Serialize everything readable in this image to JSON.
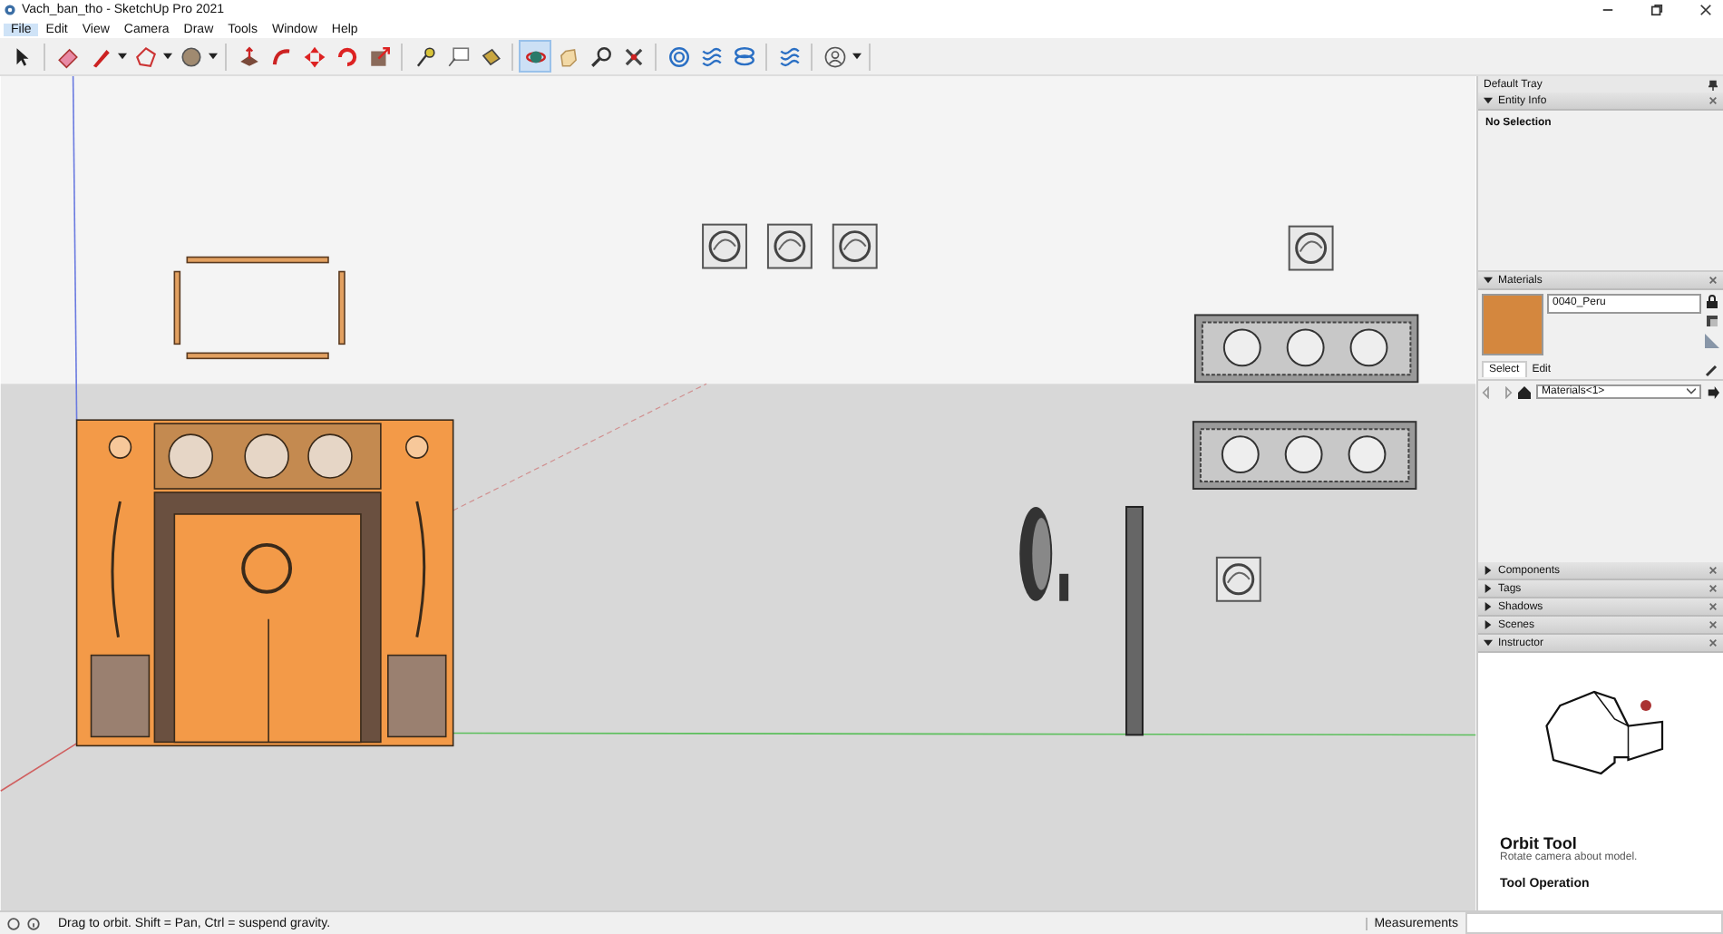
{
  "window": {
    "title": "Vach_ban_tho - SketchUp Pro 2021"
  },
  "menu": [
    {
      "label": "File",
      "selected": true
    },
    {
      "label": "Edit",
      "selected": false
    },
    {
      "label": "View",
      "selected": false
    },
    {
      "label": "Camera",
      "selected": false
    },
    {
      "label": "Draw",
      "selected": false
    },
    {
      "label": "Tools",
      "selected": false
    },
    {
      "label": "Window",
      "selected": false
    },
    {
      "label": "Help",
      "selected": false
    }
  ],
  "toolbar": [
    [
      {
        "kind": "arrow",
        "selected": false
      }
    ],
    [
      {
        "kind": "eraser",
        "selected": false
      },
      {
        "kind": "pencil",
        "selected": false
      },
      {
        "kind": "caret",
        "selected": false
      },
      {
        "kind": "polygon",
        "selected": false
      },
      {
        "kind": "caret",
        "selected": false
      },
      {
        "kind": "ball",
        "selected": false
      },
      {
        "kind": "caret",
        "selected": false
      }
    ],
    [
      {
        "kind": "push",
        "selected": false
      },
      {
        "kind": "curve",
        "selected": false
      },
      {
        "kind": "move",
        "selected": false
      },
      {
        "kind": "rotate",
        "selected": false
      },
      {
        "kind": "scale",
        "selected": false
      }
    ],
    [
      {
        "kind": "tape",
        "selected": false
      },
      {
        "kind": "label",
        "selected": false
      },
      {
        "kind": "bucket",
        "selected": false
      }
    ],
    [
      {
        "kind": "orbit",
        "selected": true
      },
      {
        "kind": "hand",
        "selected": false
      },
      {
        "kind": "zoom",
        "selected": false
      },
      {
        "kind": "cross",
        "selected": false
      }
    ],
    [
      {
        "kind": "target",
        "selected": false
      },
      {
        "kind": "waves",
        "selected": false
      },
      {
        "kind": "layers",
        "selected": false
      }
    ],
    [
      {
        "kind": "waves",
        "selected": false
      }
    ],
    [
      {
        "kind": "user",
        "selected": false
      },
      {
        "kind": "caret",
        "selected": false
      }
    ]
  ],
  "tray": {
    "title": "Default Tray",
    "entity_info": {
      "title": "Entity Info",
      "expanded": true,
      "text": "No Selection"
    },
    "materials": {
      "title": "Materials",
      "expanded": true,
      "name": "0040_Peru",
      "color": "#d4873e",
      "tabs": [
        {
          "label": "Select",
          "selected": true
        },
        {
          "label": "Edit",
          "selected": false
        }
      ],
      "collection": "Materials<1>"
    },
    "collapsed_panels": [
      {
        "title": "Components",
        "expanded": false
      },
      {
        "title": "Tags",
        "expanded": false
      },
      {
        "title": "Shadows",
        "expanded": false
      },
      {
        "title": "Scenes",
        "expanded": false
      }
    ],
    "instructor": {
      "title": "Instructor",
      "expanded": true,
      "heading": "Orbit Tool",
      "subtitle": "Rotate camera about model.",
      "section": "Tool Operation"
    }
  },
  "status_bar": {
    "message": "Drag to orbit. Shift = Pan, Ctrl = suspend gravity.",
    "measurements_label": "Measurements"
  }
}
